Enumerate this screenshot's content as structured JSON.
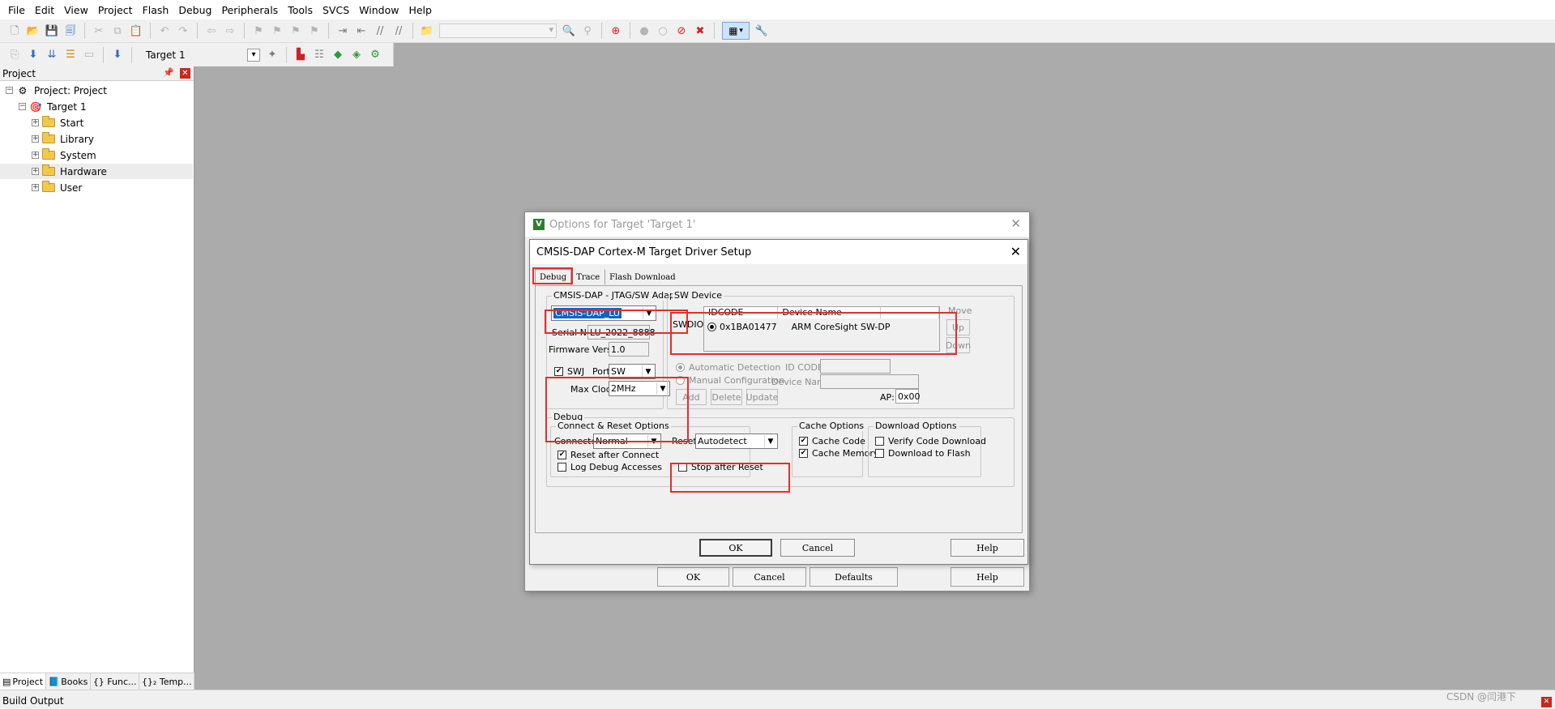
{
  "menubar": {
    "items": [
      "File",
      "Edit",
      "View",
      "Project",
      "Flash",
      "Debug",
      "Peripherals",
      "Tools",
      "SVCS",
      "Window",
      "Help"
    ]
  },
  "toolbar2": {
    "target": "Target 1"
  },
  "project_panel": {
    "title": "Project",
    "tree": [
      {
        "label": "Project: Project",
        "level": 0,
        "expander": "−",
        "icon": "project-icon"
      },
      {
        "label": "Target 1",
        "level": 1,
        "expander": "−",
        "icon": "target-icon"
      },
      {
        "label": "Start",
        "level": 2,
        "expander": "+",
        "icon": "folder-icon"
      },
      {
        "label": "Library",
        "level": 2,
        "expander": "+",
        "icon": "folder-icon"
      },
      {
        "label": "System",
        "level": 2,
        "expander": "+",
        "icon": "folder-icon"
      },
      {
        "label": "Hardware",
        "level": 2,
        "expander": "+",
        "icon": "folder-icon",
        "selected": true
      },
      {
        "label": "User",
        "level": 2,
        "expander": "+",
        "icon": "folder-icon"
      }
    ],
    "tabs": [
      {
        "label": "Project",
        "icon": "project-tab-icon"
      },
      {
        "label": "Books",
        "icon": "books-icon"
      },
      {
        "label": "{} Func...",
        "icon": "functions-icon"
      },
      {
        "label": "{}₂ Temp...",
        "icon": "templates-icon"
      }
    ]
  },
  "status": {
    "build_output": "Build Output",
    "watermark": "CSDN @闫港下"
  },
  "outer_dialog": {
    "title": "Options for Target 'Target 1'",
    "ok": "OK",
    "cancel": "Cancel",
    "defaults": "Defaults",
    "help": "Help"
  },
  "dialog": {
    "title": "CMSIS-DAP Cortex-M Target Driver Setup",
    "tabs": [
      "Debug",
      "Trace",
      "Flash Download"
    ],
    "adapter": {
      "group_title": "CMSIS-DAP - JTAG/SW Adapter",
      "selected": "CMSIS-DAP_LU",
      "serial_label": "Serial No:",
      "serial": "LU_2022_8888",
      "fw_label": "Firmware Version:",
      "fw": "1.0",
      "swj_label": "SWJ",
      "swj_checked": true,
      "port_label": "Port:",
      "port": "SW",
      "clock_label": "Max Clock:",
      "clock": "2MHz"
    },
    "sw_device": {
      "group_title": "SW Device",
      "row_label": "SWDIO",
      "col_idcode": "IDCODE",
      "col_device": "Device Name",
      "idcode": "0x1BA01477",
      "device": "ARM CoreSight SW-DP",
      "move": "Move",
      "up": "Up",
      "down": "Down",
      "auto": "Automatic Detection",
      "manual": "Manual Configuration",
      "idcode_label": "ID CODE:",
      "devname_label": "Device Name:",
      "add": "Add",
      "delete": "Delete",
      "update": "Update",
      "ap_label": "AP:",
      "ap": "0x00"
    },
    "debug": {
      "group_title": "Debug",
      "connect_group": "Connect & Reset Options",
      "connect_label": "Connect:",
      "connect": "Normal",
      "reset_label": "Reset:",
      "reset": "Autodetect",
      "reset_after_connect": "Reset after Connect",
      "log_debug": "Log Debug Accesses",
      "stop_after_reset": "Stop after Reset",
      "cache_group": "Cache Options",
      "cache_code": "Cache Code",
      "cache_memory": "Cache Memory",
      "download_group": "Download Options",
      "verify": "Verify Code Download",
      "download_flash": "Download to Flash"
    },
    "ok": "OK",
    "cancel": "Cancel",
    "help": "Help"
  }
}
